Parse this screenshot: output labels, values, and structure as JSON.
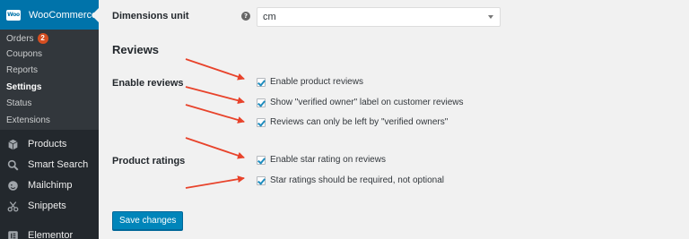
{
  "sidebar": {
    "woocommerce_label": "WooCommerce",
    "woocommerce_logo_text": "Woo",
    "submenu": [
      {
        "label": "Orders",
        "badge": "2"
      },
      {
        "label": "Coupons"
      },
      {
        "label": "Reports"
      },
      {
        "label": "Settings",
        "active": true
      },
      {
        "label": "Status"
      },
      {
        "label": "Extensions"
      }
    ],
    "menu": [
      {
        "label": "Products",
        "icon": "box-icon"
      },
      {
        "label": "Smart Search",
        "icon": "search-icon"
      },
      {
        "label": "Mailchimp",
        "icon": "mailchimp-icon"
      },
      {
        "label": "Snippets",
        "icon": "scissors-icon"
      },
      {
        "label": "Elementor",
        "icon": "elementor-icon"
      }
    ]
  },
  "main": {
    "dimensions_label": "Dimensions unit",
    "help_glyph": "?",
    "dimensions_value": "cm",
    "section_title": "Reviews",
    "enable_reviews_label": "Enable reviews",
    "product_ratings_label": "Product ratings",
    "checkboxes": [
      {
        "label": "Enable product reviews",
        "checked": true
      },
      {
        "label": "Show \"verified owner\" label on customer reviews",
        "checked": true
      },
      {
        "label": "Reviews can only be left by \"verified owners\"",
        "checked": true
      },
      {
        "label": "Enable star rating on reviews",
        "checked": true
      },
      {
        "label": "Star ratings should be required, not optional",
        "checked": true
      }
    ],
    "save_button": "Save changes"
  },
  "colors": {
    "sidebar_bg": "#23282d",
    "submenu_bg": "#32373c",
    "active_menu": "#0073aa",
    "badge": "#d54e21",
    "button": "#0085ba",
    "arrow": "#e8432b"
  }
}
